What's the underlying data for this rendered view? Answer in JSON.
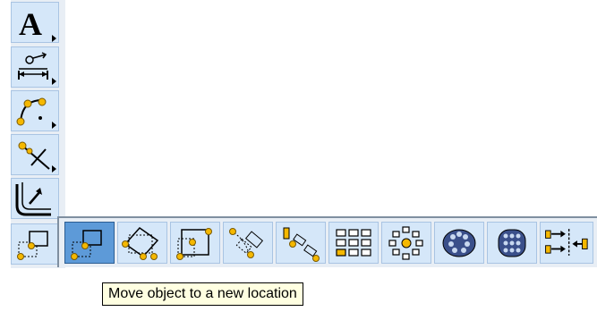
{
  "vertical_toolbar": {
    "items": [
      {
        "name": "text-tool",
        "icon": "text-A-icon",
        "glyph": "A"
      },
      {
        "name": "dimension-tool",
        "icon": "dimension-icon"
      },
      {
        "name": "arc-tool",
        "icon": "arc-icon"
      },
      {
        "name": "trim-tool",
        "icon": "trim-icon"
      },
      {
        "name": "corner-fillet-tool",
        "icon": "fillet-icon"
      },
      {
        "name": "move-object-flyout",
        "icon": "move-icon"
      }
    ]
  },
  "horizontal_toolbar": {
    "items": [
      {
        "name": "move",
        "icon": "move-icon",
        "active": true
      },
      {
        "name": "rotate",
        "icon": "rotate-icon"
      },
      {
        "name": "scale",
        "icon": "scale-icon"
      },
      {
        "name": "copy-along-path",
        "icon": "copy-path-icon"
      },
      {
        "name": "offset-copy",
        "icon": "offset-copy-icon"
      },
      {
        "name": "rectangular-array",
        "icon": "rect-array-icon"
      },
      {
        "name": "circular-array",
        "icon": "circ-array-icon"
      },
      {
        "name": "polar-pattern",
        "icon": "polar-pattern-icon"
      },
      {
        "name": "cylindrical-pattern",
        "icon": "cyl-pattern-icon"
      },
      {
        "name": "align",
        "icon": "align-icon"
      }
    ]
  },
  "tooltip": {
    "text": "Move object to a new location"
  },
  "colors": {
    "button_bg": "#d5e7f9",
    "button_border": "#a9c4e3",
    "active_bg": "#5d9ad8",
    "node_yellow": "#f5b800",
    "tooltip_bg": "#ffffe1"
  }
}
